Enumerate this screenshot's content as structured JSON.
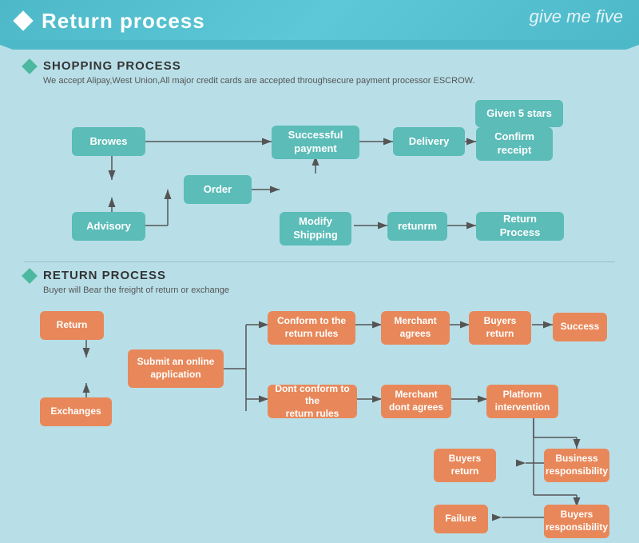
{
  "header": {
    "title": "Return process",
    "logo": "give me five",
    "diamond": "◆"
  },
  "shopping": {
    "section_title": "SHOPPING PROCESS",
    "description": "We accept Alipay,West Union,All major credit cards are accepted throughsecure payment processor ESCROW.",
    "boxes": [
      {
        "id": "browes",
        "label": "Browes"
      },
      {
        "id": "order",
        "label": "Order"
      },
      {
        "id": "advisory",
        "label": "Advisory"
      },
      {
        "id": "modify",
        "label": "Modify\nShipping"
      },
      {
        "id": "successful",
        "label": "Successful\npayment"
      },
      {
        "id": "delivery",
        "label": "Delivery"
      },
      {
        "id": "confirm",
        "label": "Confirm\nreceipt"
      },
      {
        "id": "given5",
        "label": "Given 5 stars"
      },
      {
        "id": "returnm",
        "label": "retunrm"
      },
      {
        "id": "return_process",
        "label": "Return Process"
      }
    ]
  },
  "return": {
    "section_title": "RETURN PROCESS",
    "description": "Buyer will Bear the freight of return or exchange",
    "boxes": [
      {
        "id": "return_box",
        "label": "Return"
      },
      {
        "id": "exchanges",
        "label": "Exchanges"
      },
      {
        "id": "submit",
        "label": "Submit an online\napplication"
      },
      {
        "id": "conform",
        "label": "Conform to the\nreturn rules"
      },
      {
        "id": "dont_conform",
        "label": "Dont conform to the\nreturn rules"
      },
      {
        "id": "merchant_agrees",
        "label": "Merchant\nagrees"
      },
      {
        "id": "merchant_dont",
        "label": "Merchant\ndont agrees"
      },
      {
        "id": "buyers_return1",
        "label": "Buyers\nreturn"
      },
      {
        "id": "platform",
        "label": "Platform\nintervention"
      },
      {
        "id": "success",
        "label": "Success"
      },
      {
        "id": "buyers_return2",
        "label": "Buyers\nreturn"
      },
      {
        "id": "business_resp",
        "label": "Business\nresponsibility"
      },
      {
        "id": "failure",
        "label": "Failure"
      },
      {
        "id": "buyers_resp",
        "label": "Buyers\nresponsibility"
      }
    ]
  }
}
